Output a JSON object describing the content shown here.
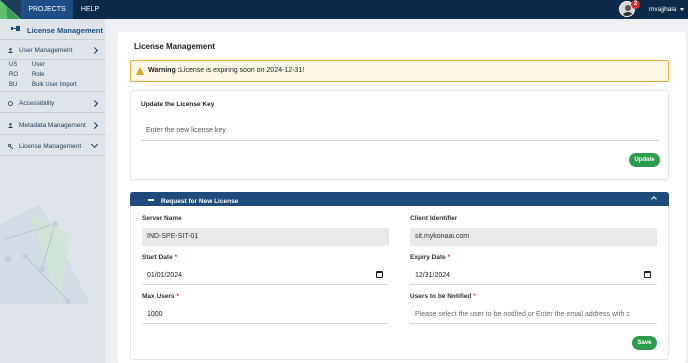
{
  "topbar": {
    "tabs": [
      "PROJECTS",
      "HELP"
    ],
    "notification_count": "2",
    "username": "mvajjhala"
  },
  "sidebar": {
    "title": "License Management",
    "sections": [
      {
        "label": "User Management",
        "icon": "user-icon"
      },
      {
        "label": "Accessibility",
        "icon": "accessibility-icon"
      },
      {
        "label": "Metadata Management",
        "icon": "user-icon"
      },
      {
        "label": "License Management",
        "icon": "key-icon"
      }
    ],
    "sub_items": [
      {
        "abbr": "US",
        "name": "User"
      },
      {
        "abbr": "RO",
        "name": "Role"
      },
      {
        "abbr": "BU",
        "name": "Bulk User Import"
      }
    ]
  },
  "main": {
    "title": "License Management",
    "warning_label": "Warning :",
    "warning_text": "License is expiring soon on 2024-12-31!",
    "update_card": {
      "title": "Update the License Key",
      "placeholder": "Enter the new license key",
      "button": "Update"
    },
    "request_section": {
      "title": "Request for New License",
      "server_name_label": "Server Name",
      "server_name": "IND-SPE-SIT-01",
      "client_identifier_label": "Client Identifier",
      "client_identifier": "sit.mykonaai.com",
      "start_date_label": "Start Date",
      "start_date": "01/01/2024",
      "expiry_date_label": "Expiry Date",
      "expiry_date": "12/31/2024",
      "max_users_label": "Max Users",
      "max_users": "1000",
      "notify_label": "Users to be Notified",
      "notify_placeholder": "Please select the user to be notified or Enter the email address with c",
      "required_mark": "*",
      "save_button": "Save"
    }
  },
  "colors": {
    "topbar": "#0d2a4a",
    "active_tab": "#1d4f86",
    "accordion_header": "#1e4d7b",
    "button_green": "#2e9c4d",
    "warning_border": "#f0a83a",
    "required": "#d32f2f"
  }
}
